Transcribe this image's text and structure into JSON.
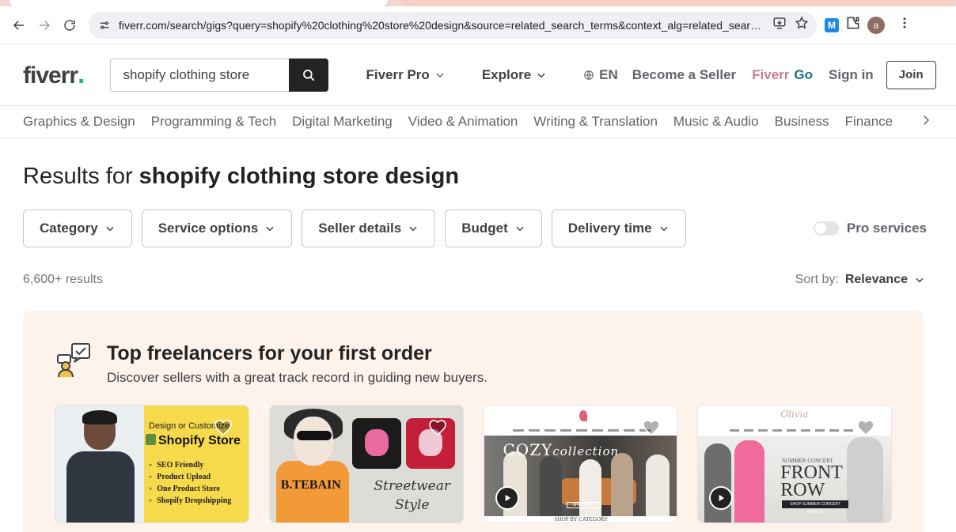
{
  "browser": {
    "url": "fiverr.com/search/gigs?query=shopify%20clothing%20store%20design&source=related_search_terms&context_alg=related_searc...",
    "profile_initial": "a",
    "extension_label": "M"
  },
  "header": {
    "logo_text": "fiverr",
    "logo_dot": ".",
    "search_value": "shopify clothing store",
    "nav": {
      "fiverr_pro": "Fiverr Pro",
      "explore": "Explore",
      "language": "EN",
      "become_seller": "Become a Seller",
      "fiverr_go_part1": "Fiverr",
      "fiverr_go_part2": " Go",
      "sign_in": "Sign in",
      "join": "Join"
    }
  },
  "categories": [
    "Graphics & Design",
    "Programming & Tech",
    "Digital Marketing",
    "Video & Animation",
    "Writing & Translation",
    "Music & Audio",
    "Business",
    "Finance"
  ],
  "main": {
    "results_prefix": "Results for ",
    "results_query": "shopify clothing store design",
    "filters": [
      "Category",
      "Service options",
      "Seller details",
      "Budget",
      "Delivery time"
    ],
    "pro_services_label": "Pro services",
    "pro_services_on": false,
    "results_count": "6,600+ results",
    "sort_label": "Sort by:",
    "sort_value": "Relevance"
  },
  "promo": {
    "title": "Top freelancers for your first order",
    "subtitle": "Discover sellers with a great track record in guiding new buyers.",
    "cards": {
      "c1": {
        "small": "Design or Customize",
        "big": "Shopify Store",
        "bullets": [
          "SEO Friendly",
          "Product Upload",
          "One Product Store",
          "Shopify Dropshipping"
        ]
      },
      "c2": {
        "brand": "B.TEBAIN",
        "script_line1": "Streetwear",
        "script_line2": "Style"
      },
      "c3": {
        "headline": "COZY",
        "headline_small": "collection",
        "shop_now": "SHOP NOW",
        "bottom": "SHOP BY CATEGORY"
      },
      "c4": {
        "logo": "Olivia",
        "small": "SUMMER CONCERT",
        "front_line1": "FRONT",
        "front_line2": "ROW",
        "shop_button": "SHOP SUMMER CONCERT OUTFITS"
      }
    }
  }
}
